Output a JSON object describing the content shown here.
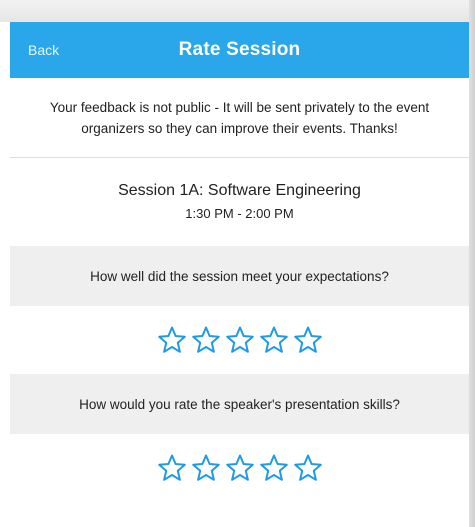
{
  "nav": {
    "back_label": "Back",
    "title": "Rate Session"
  },
  "notice": {
    "text": "Your feedback is not public - It will be sent privately to the event organizers so they can improve their events. Thanks!"
  },
  "session": {
    "name": "Session 1A: Software Engineering",
    "time": "1:30 PM - 2:00 PM"
  },
  "questions": [
    {
      "text": "How well did the session meet your expectations?",
      "rating": 0,
      "max_rating": 5
    },
    {
      "text": "How would you rate the speaker's presentation skills?",
      "rating": 0,
      "max_rating": 5
    }
  ],
  "colors": {
    "accent": "#2aa6ea",
    "star_outline": "#1e9be6"
  },
  "icons": {
    "star": "star-outline-icon"
  }
}
